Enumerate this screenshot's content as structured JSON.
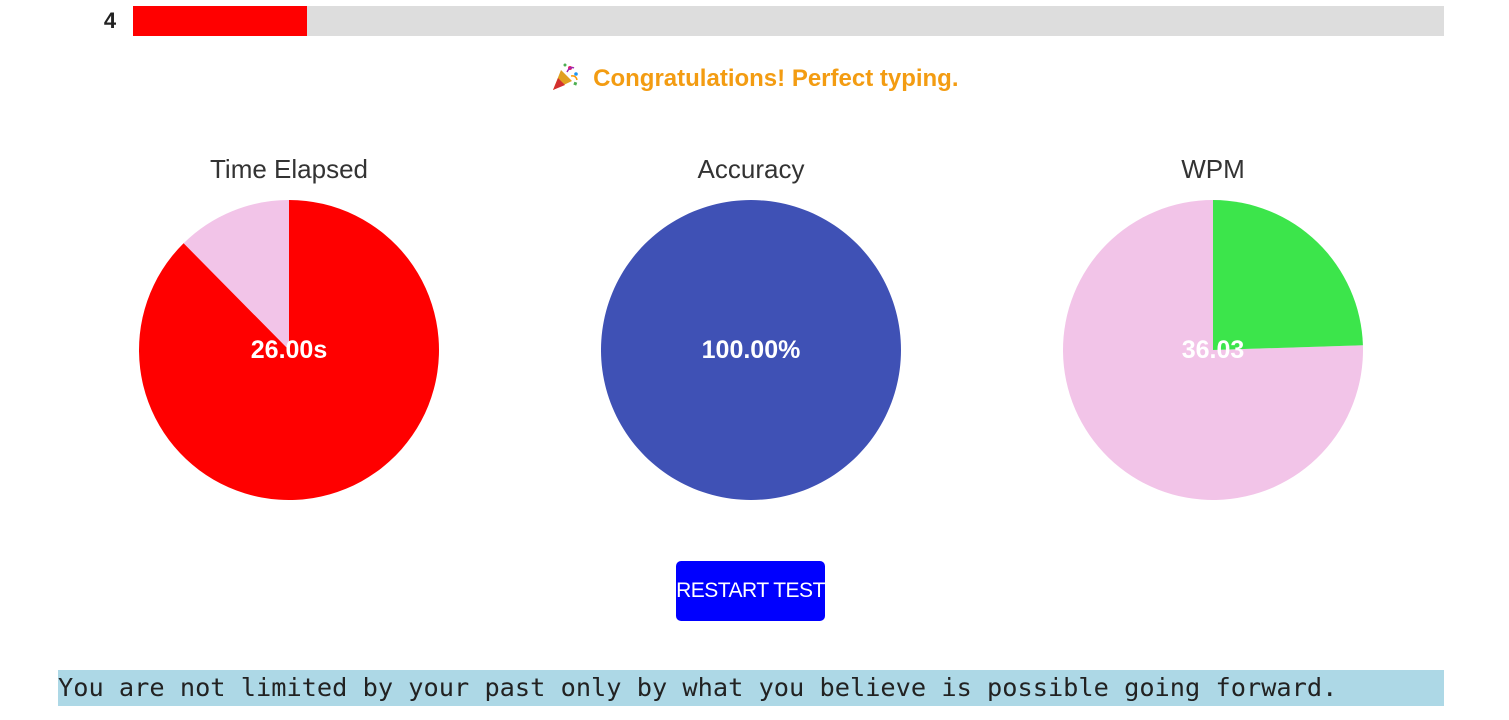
{
  "progress": {
    "count": "4",
    "fraction": 0.133,
    "fill_color": "#ff0000",
    "track_color": "#dddddd"
  },
  "message": {
    "icon": "party-popper-icon",
    "text": "Congratulations! Perfect typing."
  },
  "charts": [
    {
      "title": "Time Elapsed",
      "label": "26.00s",
      "fraction": 0.876,
      "start": "top",
      "direction": "clockwise",
      "value_color": "#ff0000",
      "rest_color": "#f2c4e8"
    },
    {
      "title": "Accuracy",
      "label": "100.00%",
      "fraction": 1.0,
      "start": "top",
      "direction": "clockwise",
      "value_color": "#3f51b5",
      "rest_color": "#f2c4e8"
    },
    {
      "title": "WPM",
      "label": "36.03",
      "fraction": 0.245,
      "start": "top",
      "direction": "clockwise",
      "value_color": "#3ce54b",
      "rest_color": "#f2c4e8"
    }
  ],
  "restart_button": {
    "label": "RESTART TEST",
    "color": "#0000ff"
  },
  "quote": {
    "text": "You are not limited by your past only by what you believe is possible going forward.",
    "highlight_color": "#add8e6"
  }
}
